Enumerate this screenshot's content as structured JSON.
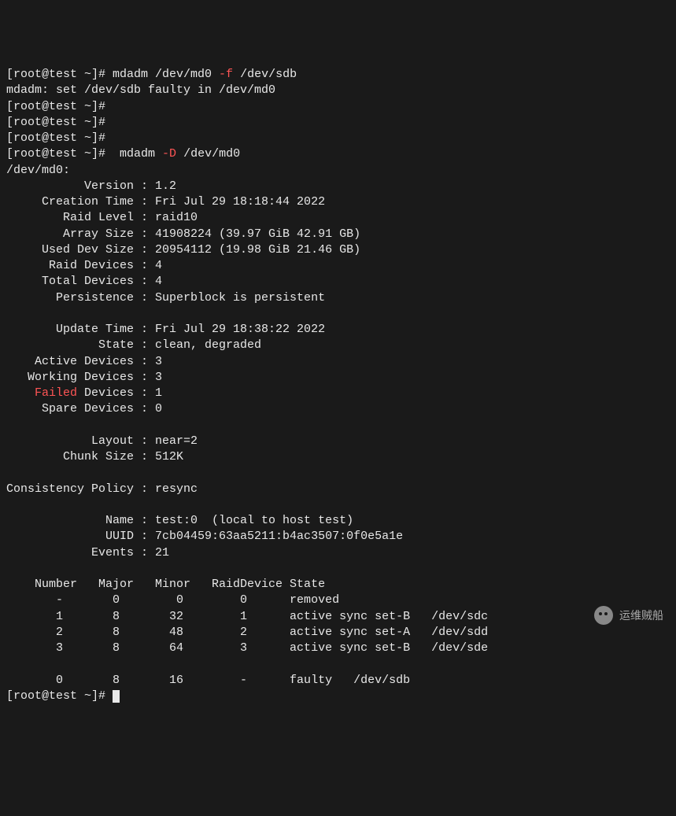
{
  "prompt_user": "root",
  "prompt_host": "test",
  "prompt_path": "~",
  "lines": [
    {
      "segs": [
        {
          "t": "[root@test ~]# mdadm /dev/md0 "
        },
        {
          "t": "-f",
          "c": "red"
        },
        {
          "t": " /dev/sdb"
        }
      ]
    },
    {
      "segs": [
        {
          "t": "mdadm: set /dev/sdb faulty in /dev/md0"
        }
      ]
    },
    {
      "segs": [
        {
          "t": "[root@test ~]#"
        }
      ]
    },
    {
      "segs": [
        {
          "t": "[root@test ~]#"
        }
      ]
    },
    {
      "segs": [
        {
          "t": "[root@test ~]#"
        }
      ]
    },
    {
      "segs": [
        {
          "t": "[root@test ~]#  mdadm "
        },
        {
          "t": "-D",
          "c": "red"
        },
        {
          "t": " /dev/md0"
        }
      ]
    },
    {
      "segs": [
        {
          "t": "/dev/md0:"
        }
      ]
    },
    {
      "segs": [
        {
          "t": "           Version : 1.2"
        }
      ]
    },
    {
      "segs": [
        {
          "t": "     Creation Time : Fri Jul 29 18:18:44 2022"
        }
      ]
    },
    {
      "segs": [
        {
          "t": "        Raid Level : raid10"
        }
      ]
    },
    {
      "segs": [
        {
          "t": "        Array Size : 41908224 (39.97 GiB 42.91 GB)"
        }
      ]
    },
    {
      "segs": [
        {
          "t": "     Used Dev Size : 20954112 (19.98 GiB 21.46 GB)"
        }
      ]
    },
    {
      "segs": [
        {
          "t": "      Raid Devices : 4"
        }
      ]
    },
    {
      "segs": [
        {
          "t": "     Total Devices : 4"
        }
      ]
    },
    {
      "segs": [
        {
          "t": "       Persistence : Superblock is persistent"
        }
      ]
    },
    {
      "segs": [
        {
          "t": ""
        }
      ]
    },
    {
      "segs": [
        {
          "t": "       Update Time : Fri Jul 29 18:38:22 2022"
        }
      ]
    },
    {
      "segs": [
        {
          "t": "             State : clean, degraded"
        }
      ]
    },
    {
      "segs": [
        {
          "t": "    Active Devices : 3"
        }
      ]
    },
    {
      "segs": [
        {
          "t": "   Working Devices : 3"
        }
      ]
    },
    {
      "segs": [
        {
          "t": "    "
        },
        {
          "t": "Failed",
          "c": "red"
        },
        {
          "t": " Devices : 1"
        }
      ]
    },
    {
      "segs": [
        {
          "t": "     Spare Devices : 0"
        }
      ]
    },
    {
      "segs": [
        {
          "t": ""
        }
      ]
    },
    {
      "segs": [
        {
          "t": "            Layout : near=2"
        }
      ]
    },
    {
      "segs": [
        {
          "t": "        Chunk Size : 512K"
        }
      ]
    },
    {
      "segs": [
        {
          "t": ""
        }
      ]
    },
    {
      "segs": [
        {
          "t": "Consistency Policy : resync"
        }
      ]
    },
    {
      "segs": [
        {
          "t": ""
        }
      ]
    },
    {
      "segs": [
        {
          "t": "              Name : test:0  (local to host test)"
        }
      ]
    },
    {
      "segs": [
        {
          "t": "              UUID : 7cb04459:63aa5211:b4ac3507:0f0e5a1e"
        }
      ]
    },
    {
      "segs": [
        {
          "t": "            Events : 21"
        }
      ]
    },
    {
      "segs": [
        {
          "t": ""
        }
      ]
    },
    {
      "segs": [
        {
          "t": "    Number   Major   Minor   RaidDevice State"
        }
      ]
    },
    {
      "segs": [
        {
          "t": "       -       0        0        0      removed"
        }
      ]
    },
    {
      "segs": [
        {
          "t": "       1       8       32        1      active sync set-B   /dev/sdc"
        }
      ]
    },
    {
      "segs": [
        {
          "t": "       2       8       48        2      active sync set-A   /dev/sdd"
        }
      ]
    },
    {
      "segs": [
        {
          "t": "       3       8       64        3      active sync set-B   /dev/sde"
        }
      ]
    },
    {
      "segs": [
        {
          "t": ""
        }
      ]
    },
    {
      "segs": [
        {
          "t": "       0       8       16        -      faulty   /dev/sdb"
        }
      ]
    },
    {
      "segs": [
        {
          "t": "[root@test ~]# "
        },
        {
          "cursor": true
        }
      ]
    }
  ],
  "mdadm_detail": {
    "device": "/dev/md0",
    "Version": "1.2",
    "Creation Time": "Fri Jul 29 18:18:44 2022",
    "Raid Level": "raid10",
    "Array Size": "41908224 (39.97 GiB 42.91 GB)",
    "Used Dev Size": "20954112 (19.98 GiB 21.46 GB)",
    "Raid Devices": 4,
    "Total Devices": 4,
    "Persistence": "Superblock is persistent",
    "Update Time": "Fri Jul 29 18:38:22 2022",
    "State": "clean, degraded",
    "Active Devices": 3,
    "Working Devices": 3,
    "Failed Devices": 1,
    "Spare Devices": 0,
    "Layout": "near=2",
    "Chunk Size": "512K",
    "Consistency Policy": "resync",
    "Name": "test:0  (local to host test)",
    "UUID": "7cb04459:63aa5211:b4ac3507:0f0e5a1e",
    "Events": 21,
    "devices": [
      {
        "Number": "-",
        "Major": 0,
        "Minor": 0,
        "RaidDevice": 0,
        "State": "removed",
        "path": ""
      },
      {
        "Number": 1,
        "Major": 8,
        "Minor": 32,
        "RaidDevice": 1,
        "State": "active sync set-B",
        "path": "/dev/sdc"
      },
      {
        "Number": 2,
        "Major": 8,
        "Minor": 48,
        "RaidDevice": 2,
        "State": "active sync set-A",
        "path": "/dev/sdd"
      },
      {
        "Number": 3,
        "Major": 8,
        "Minor": 64,
        "RaidDevice": 3,
        "State": "active sync set-B",
        "path": "/dev/sde"
      },
      {
        "Number": 0,
        "Major": 8,
        "Minor": 16,
        "RaidDevice": "-",
        "State": "faulty",
        "path": "/dev/sdb"
      }
    ]
  },
  "watermark_text": "运维贼船"
}
